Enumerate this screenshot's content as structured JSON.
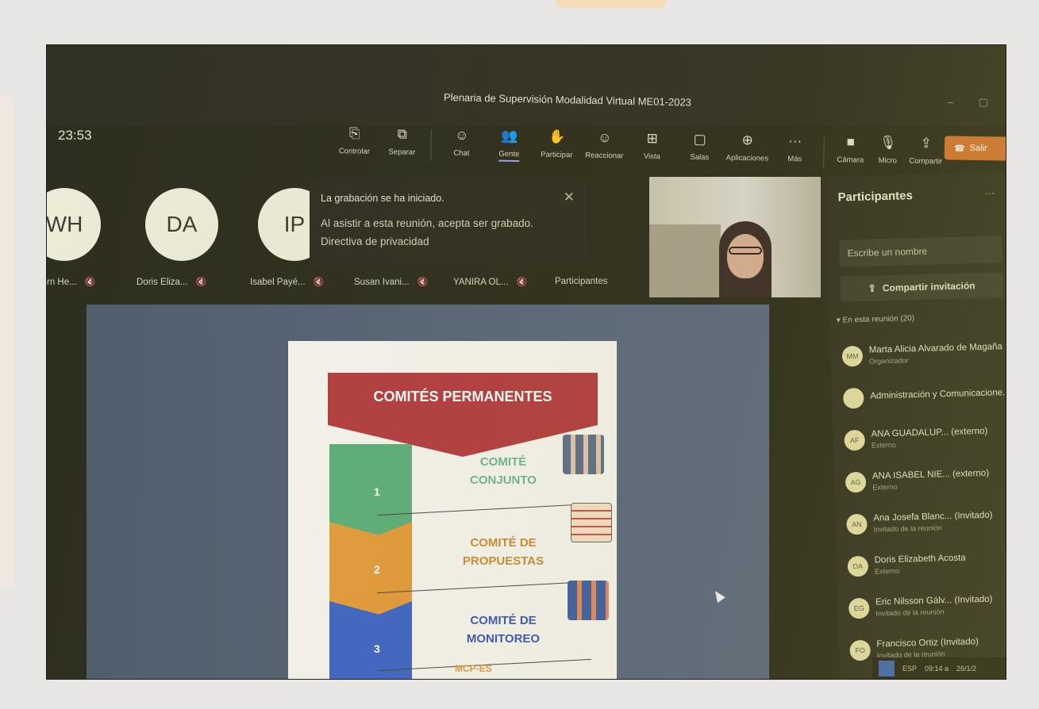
{
  "meeting": {
    "title": "Plenaria de Supervisión Modalidad Virtual ME01-2023",
    "elapsed": "23:53",
    "window_controls": "– ▢"
  },
  "toolbar": {
    "buttons": [
      {
        "label": "Controlar",
        "icon": "control-icon",
        "glyph": "⎘"
      },
      {
        "label": "Separar",
        "icon": "popout-icon",
        "glyph": "⧉"
      },
      {
        "label": "Chat",
        "icon": "chat-icon",
        "glyph": "☺"
      },
      {
        "label": "Gente",
        "icon": "people-icon",
        "glyph": "👥"
      },
      {
        "label": "Participar",
        "icon": "raise-hand-icon",
        "glyph": "✋"
      },
      {
        "label": "Reaccionar",
        "icon": "react-icon",
        "glyph": "☺"
      },
      {
        "label": "Vista",
        "icon": "view-icon",
        "glyph": "⊞"
      },
      {
        "label": "Salas",
        "icon": "rooms-icon",
        "glyph": "▢"
      },
      {
        "label": "Aplicaciones",
        "icon": "apps-icon",
        "glyph": "⊕"
      },
      {
        "label": "Más",
        "icon": "more-icon",
        "glyph": "···"
      },
      {
        "label": "Cámara",
        "icon": "camera-icon",
        "glyph": "■"
      },
      {
        "label": "Micro",
        "icon": "mic-icon",
        "glyph": "🎙"
      },
      {
        "label": "Compartir",
        "icon": "share-icon",
        "glyph": "⇪"
      }
    ],
    "leave_label": "Salir",
    "leave_glyph": "☎"
  },
  "gallery": {
    "avatars": [
      {
        "initials": "WH",
        "name": "rn He..."
      },
      {
        "initials": "DA",
        "name": "Doris Eliza..."
      },
      {
        "initials": "IP",
        "name": "Isabel Payé..."
      }
    ],
    "more_names": [
      "Susan Ivani...",
      "YANIRA OL..."
    ],
    "mic_glyph": "🔇",
    "participants_label": "Participantes"
  },
  "notification": {
    "title": "La grabación se ha iniciado.",
    "body": "Al asistir a esta reunión, acepta ser grabado.",
    "link": "Directiva de privacidad",
    "close_glyph": "✕"
  },
  "slide": {
    "banner": "COMITÉS PERMANENTES",
    "committees": [
      {
        "num": "1",
        "line1": "COMITÉ",
        "line2": "CONJUNTO"
      },
      {
        "num": "2",
        "line1": "COMITÉ DE",
        "line2": "PROPUESTAS"
      },
      {
        "num": "3",
        "line1": "COMITÉ DE",
        "line2": "MONITOREO"
      }
    ],
    "logo_text": "MCP-ES"
  },
  "panel": {
    "title": "Participantes",
    "more_glyph": "···",
    "search_placeholder": "Escribe un nombre",
    "invite_label": "Compartir invitación",
    "invite_glyph": "⇪",
    "section_label": "▾ En esta reunión (20)",
    "participants": [
      {
        "initials": "MM",
        "name": "Marta Alicia Alvarado de Magaña",
        "role": "Organizador"
      },
      {
        "initials": "",
        "name": "Administración y Comunicacione...",
        "role": ""
      },
      {
        "initials": "AF",
        "name": "ANA GUADALUP... (externo)",
        "role": "Externo"
      },
      {
        "initials": "AG",
        "name": "ANA ISABEL NIE... (externo)",
        "role": "Externo"
      },
      {
        "initials": "AN",
        "name": "Ana Josefa Blanc... (Invitado)",
        "role": "Invitado de la reunión"
      },
      {
        "initials": "DA",
        "name": "Doris Elizabeth Acosta",
        "role": "Externo"
      },
      {
        "initials": "EG",
        "name": "Eric Nilsson Gálv... (Invitado)",
        "role": "Invitado de la reunión"
      },
      {
        "initials": "FO",
        "name": "Francisco Ortiz (Invitado)",
        "role": "Invitado de la reunión"
      }
    ]
  },
  "taskbar": {
    "lang": "ESP",
    "time": "09:14 a",
    "date": "26/1/2"
  }
}
